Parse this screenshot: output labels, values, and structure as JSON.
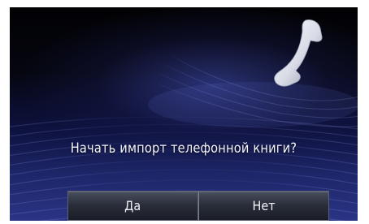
{
  "dialog": {
    "prompt": "Начать импорт телефонной книги?",
    "icon": "phone-handset-icon"
  },
  "buttons": {
    "yes_label": "Да",
    "no_label": "Нет"
  },
  "colors": {
    "background_top": "#020204",
    "background_bottom": "#2a3484",
    "text": "#f4f5fb",
    "button_top": "#4a4f5e",
    "button_bottom": "#1a1d26"
  }
}
